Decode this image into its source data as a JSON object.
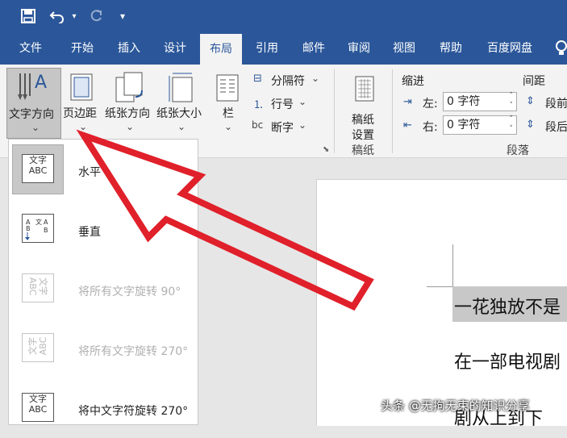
{
  "qat": {
    "customize": "▾"
  },
  "tabs": [
    "文件",
    "开始",
    "插入",
    "设计",
    "布局",
    "引用",
    "邮件",
    "审阅",
    "视图",
    "帮助",
    "百度网盘"
  ],
  "ribbon": {
    "text_direction": "文字方向",
    "margins": "页边距",
    "orientation": "纸张方向",
    "size": "纸张大小",
    "columns": "栏",
    "breaks": "分隔符",
    "line_numbers": "行号",
    "hyphenation": "断字",
    "manuscript_line1": "稿纸",
    "manuscript_line2": "设置",
    "manuscript_group": "稿纸",
    "indent_header": "缩进",
    "spacing_header": "间距",
    "indent_left_label": "左:",
    "indent_left_value": "0 字符",
    "indent_right_label": "右:",
    "indent_right_value": "0 字符",
    "spacing_before": "段前",
    "spacing_after": "段后",
    "paragraph_group": "段落"
  },
  "dropdown": {
    "items": [
      {
        "label": "水平",
        "icon_text": "文字\nABC",
        "enabled": true,
        "selected": true
      },
      {
        "label": "垂直",
        "icon_text": "ABC",
        "enabled": true,
        "selected": false
      },
      {
        "label": "将所有文字旋转 90°",
        "icon_text": "ABC文字",
        "enabled": false,
        "selected": false
      },
      {
        "label": "将所有文字旋转 270°",
        "icon_text": "文字ABC",
        "enabled": false,
        "selected": false
      },
      {
        "label": "将中文字符旋转 270°",
        "icon_text": "文字\nABC",
        "enabled": true,
        "selected": false
      }
    ]
  },
  "document": {
    "line1": "一花独放不是",
    "line2": "在一部电视剧",
    "line3": "剧从上到下",
    "watermark": "头条 @无拘无束的知识分享"
  },
  "colors": {
    "ribbon_blue": "#2b579a",
    "arrow_red": "#e0202a",
    "highlight": "#c8c8c8"
  }
}
